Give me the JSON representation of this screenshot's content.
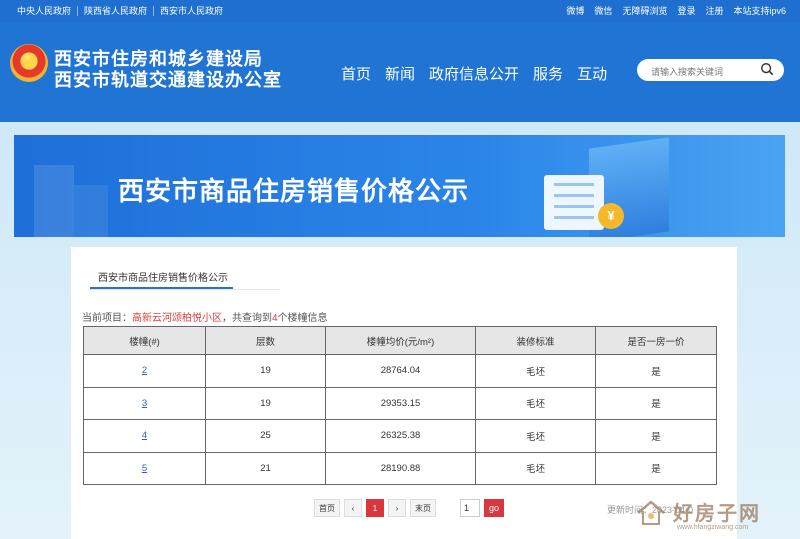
{
  "topbar": {
    "links_left": [
      "中央人民政府",
      "陕西省人民政府",
      "西安市人民政府"
    ],
    "links_right": [
      "微博",
      "微信",
      "无障碍浏览",
      "登录",
      "注册",
      "本站支持ipv6"
    ]
  },
  "header": {
    "title_line1": "西安市住房和城乡建设局",
    "title_line2": "西安市轨道交通建设办公室",
    "nav": [
      "首页",
      "新闻",
      "政府信息公开",
      "服务",
      "互动"
    ],
    "search_placeholder": "请输入搜索关键词"
  },
  "banner": {
    "title": "西安市商品住房销售价格公示",
    "coin_symbol": "¥"
  },
  "tab": {
    "label": "西安市商品住房销售价格公示"
  },
  "info": {
    "prefix": "当前项目：",
    "project": "高新云河颂柏悦小区",
    "middle": "，共查询到",
    "count": "4",
    "suffix": "个楼幢信息"
  },
  "table": {
    "headers": [
      "楼幢(#)",
      "层数",
      "楼幢均价(元/m²)",
      "装修标准",
      "是否一房一价"
    ],
    "rows": [
      [
        "2",
        "19",
        "28764.04",
        "毛坯",
        "是"
      ],
      [
        "3",
        "19",
        "29353.15",
        "毛坯",
        "是"
      ],
      [
        "4",
        "25",
        "26325.38",
        "毛坯",
        "是"
      ],
      [
        "5",
        "21",
        "28190.88",
        "毛坯",
        "是"
      ]
    ]
  },
  "pager": {
    "first": "首页",
    "prev": "‹",
    "current": "1",
    "next": "›",
    "last": "末页",
    "goto_value": "1",
    "go": "go"
  },
  "updated": "更新时间：2023-04-0",
  "watermark": {
    "text": "好房子网",
    "url": "www.hfangziwang.com"
  },
  "colors": {
    "primary": "#1f74d4",
    "accent": "#d9363e",
    "highlight": "#e0403b"
  }
}
